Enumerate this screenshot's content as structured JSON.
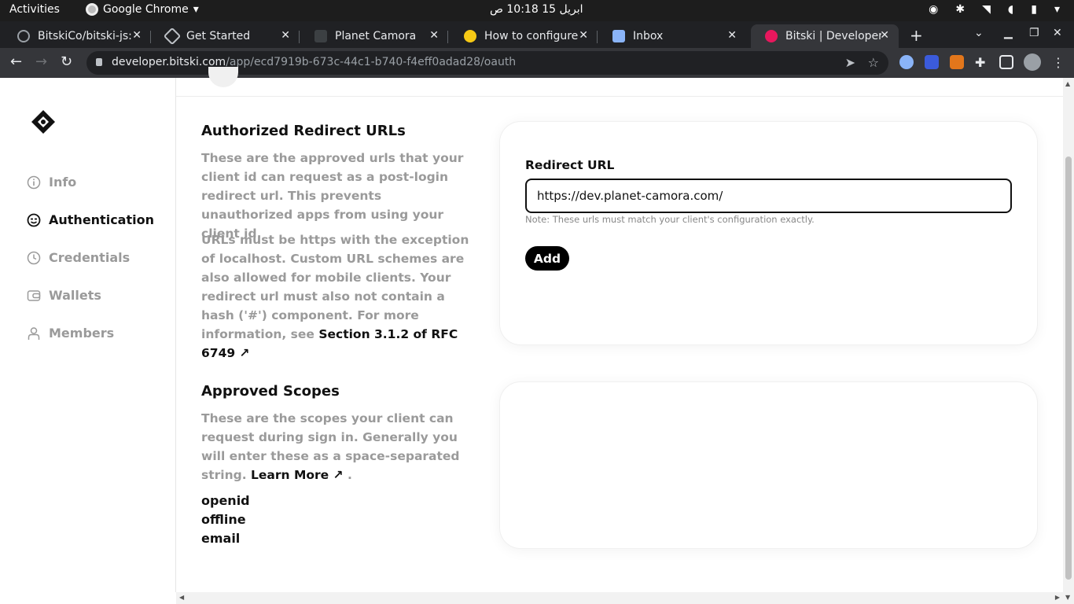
{
  "system": {
    "activities": "Activities",
    "app_name": "Google Chrome",
    "clock": "ابريل 15  10:18 ص"
  },
  "tabs": [
    {
      "title": "BitskiCo/bitski-js: ",
      "favicon_color": "#202124"
    },
    {
      "title": "Get Started",
      "favicon_color": "#202124"
    },
    {
      "title": "Planet Camora",
      "favicon_color": "#3c4043"
    },
    {
      "title": "How to configure",
      "favicon_color": "#f6c915"
    },
    {
      "title": "Inbox",
      "favicon_color": "#8ab4f8"
    },
    {
      "title": "Bitski | Developer ",
      "favicon_color": "#e8175d",
      "active": true
    }
  ],
  "browser": {
    "url_host": "developer.bitski.com",
    "url_path": "/app/ecd7919b-673c-44c1-b740-f4eff0adad28/oauth"
  },
  "sidebar": {
    "items": [
      {
        "label": "Info",
        "icon": "info-icon"
      },
      {
        "label": "Authentication",
        "icon": "smiley-icon",
        "active": true
      },
      {
        "label": "Credentials",
        "icon": "clock-icon"
      },
      {
        "label": "Wallets",
        "icon": "wallet-icon"
      },
      {
        "label": "Members",
        "icon": "person-icon"
      }
    ]
  },
  "redirect_section": {
    "title": "Authorized Redirect URLs",
    "desc_1": "These are the approved urls that your client id can request as a post-login redirect url. This prevents unauthorized apps from using your client id.",
    "desc_2": "URLs must be https with the exception of localhost. Custom URL schemes are also allowed for mobile clients. Your redirect url must also not contain a hash ('#') component. For more information, see",
    "link": "Section 3.1.2 of RFC 6749",
    "field_label": "Redirect URL",
    "field_value": "https://dev.planet-camora.com/",
    "note": "Note: These urls must match your client's configuration exactly.",
    "add_label": "Add"
  },
  "scopes_section": {
    "title": "Approved Scopes",
    "desc": "These are the scopes your client can request during sign in. Generally you will enter these as a space-separated string.",
    "link": "Learn More",
    "scopes": [
      "openid",
      "offline",
      "email"
    ]
  },
  "colors": {
    "accent": "#000000",
    "muted_text": "#9a9a9a",
    "brand": "#e8175d"
  }
}
